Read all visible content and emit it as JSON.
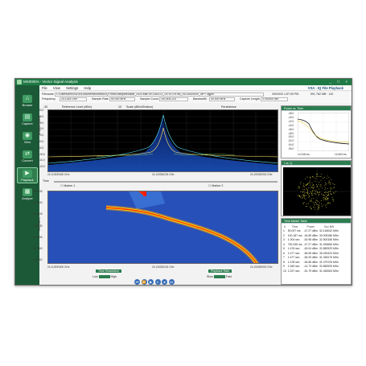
{
  "app": {
    "title": "MX0000A - Vector Signal Analysis",
    "mode_label": "VSA - IQ File Playback",
    "window_buttons": "_ □ ×"
  },
  "menu": [
    "File",
    "View",
    "Settings",
    "Help"
  ],
  "sidebar": [
    {
      "label": "Browse",
      "icon": "browse-icon",
      "glyph": "⌂",
      "active": false
    },
    {
      "label": "Capture",
      "icon": "capture-icon",
      "glyph": "▤",
      "active": false
    },
    {
      "label": "View",
      "icon": "view-icon",
      "glyph": "◉",
      "active": false
    },
    {
      "label": "Convert",
      "icon": "convert-icon",
      "glyph": "⇄",
      "active": false
    },
    {
      "label": "Playback",
      "icon": "playback-icon",
      "glyph": "▶",
      "active": true
    },
    {
      "label": "Analyze",
      "icon": "analyze-icon",
      "glyph": "▦",
      "active": false
    }
  ],
  "fields": {
    "filename_label": "Filename",
    "filename_value": "C:\\Users\\anr004100\\Documents\\Anritsu\\IQ Files\\Examples\\radar_2020-Mar-09-1354-01_10791729.hsi_24133000000_4e+7.dgpm",
    "timestamp": "3/9/2020 1:57:09 PM",
    "samples_info": "591 762 MB · 110",
    "frequency_label": "Frequency",
    "frequency_value": "24.1333 GHz",
    "sample_rate_label": "Sample Rate",
    "sample_rate_value": "50.000 MHz",
    "sample_count_label": "Sample Count",
    "sample_count_value": "152,505,224",
    "bandwidth_label": "Bandwidth",
    "bandwidth_value": "40.000 MHz",
    "capture_length_label": "Capture Length",
    "capture_length_value": "3.000000 sec"
  },
  "spectrum": {
    "ref_level_label": "Reference Level (dBm)",
    "ref_level_value": "-30",
    "scale_label": "Scale (dBm/Division)",
    "scale_value": "10",
    "persistence_label": "Persistence",
    "y_axis_label": "Amplitude (dBm)",
    "y_ticks": [
      "-30.0",
      "-40.0",
      "-50.0",
      "-60.0",
      "-70.0",
      "-80.0",
      "-90.0",
      "-100.0",
      "-110.0",
      "-120.0"
    ],
    "x_left": "24.113339400 GHz",
    "x_center": "24.133330224 GHz",
    "x_right": "24.153330902 GHz"
  },
  "time_bar": {
    "label": "Time",
    "marker1": "Marker 1",
    "marker2": "Marker 2"
  },
  "waterfall": {
    "y_axis_label": "Time (msec)",
    "y_ticks": [
      "1478.35",
      "1478.40",
      "1478.45",
      "1478.50",
      "1478.55",
      "1478.60",
      "1478.62"
    ],
    "x_left": "24.113339400 GHz",
    "x_center": "24.133330224 GHz",
    "x_right": "24.153330902 GHz"
  },
  "controls": {
    "time_resolution_label": "Time Resolution",
    "low": "Low",
    "high": "High",
    "playback_rate_label": "Playback Rate",
    "slow": "Slow",
    "fast": "Fast",
    "transport": [
      "⏮",
      "⏪",
      "▶",
      "⏸",
      "⏹",
      "⏭"
    ]
  },
  "power_vs_time": {
    "title": "Power vs. Time",
    "y_label": "Amplitude (dBm)",
    "y_ticks": [
      "-38.0",
      "-40.0",
      "-42.0",
      "-44.0",
      "-46.0",
      "-48.0",
      "-50.0",
      "-52.0",
      "-54.0",
      "-56.0"
    ],
    "x_left": "14.348 ms",
    "x_right": "14.663 ms"
  },
  "iq_plot": {
    "title": "I vs. Q"
  },
  "marker_table": {
    "title": "Time Marker Table",
    "headers": [
      "#",
      "Time",
      "Power",
      "Occ BW"
    ],
    "rows": [
      [
        "1",
        "50.007 ms",
        "-47.27 dBm",
        "32.146042 MHz"
      ],
      [
        "2",
        "100.187 ms",
        "-44.89 dBm",
        "33.005186 MHz"
      ],
      [
        "3",
        "1.004 sec",
        "-52.98 dBm",
        "32.500156 MHz"
      ],
      [
        "4",
        "752.035 ms",
        "-47.27 dBm",
        "31.053656 MHz"
      ],
      [
        "5",
        "1.476 sec",
        "-63.04 dBm",
        "32.882929 MHz"
      ],
      [
        "6",
        "1.477 sec",
        "-56.95 dBm",
        "35.252423 MHz"
      ],
      [
        "7",
        "1.477 sec",
        "-65.25 dBm",
        "31.348176 MHz"
      ],
      [
        "8",
        "1.478 sec",
        "-54.86 dBm",
        "31.479726 MHz"
      ],
      [
        "9",
        "1.543 sec",
        "-41.73 dBm",
        "32.882929 MHz"
      ],
      [
        "10",
        "2.227 sec",
        "-51.79 dBm",
        "31.452063 MHz"
      ]
    ]
  },
  "colors": {
    "brand": "#1f7a45",
    "sidebar": "#1c5a37",
    "trace": "#ffe76a",
    "waterfall": "#2b62cf",
    "hot": "#ff2a00"
  }
}
